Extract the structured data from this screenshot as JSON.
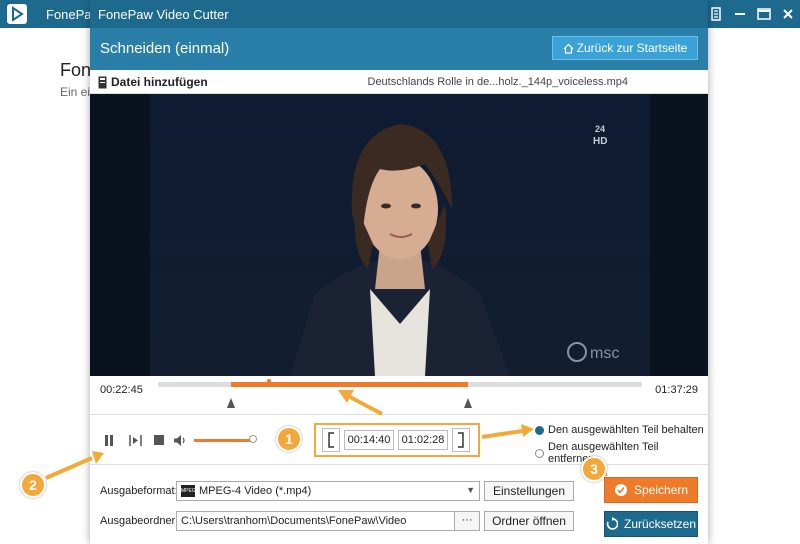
{
  "outer": {
    "title": "FonePaw",
    "heading": "Fone",
    "sub": "Ein ei"
  },
  "cutter": {
    "title": "FonePaw Video Cutter",
    "mode_title": "Schneiden (einmal)",
    "home_button": "Zurück zur Startseite"
  },
  "file": {
    "add_label": "Datei hinzufügen",
    "name": "Deutschlands Rolle in de...holz._144p_voiceless.mp4"
  },
  "video": {
    "channel_logo": "24 HD",
    "watermark": "msc"
  },
  "timeline": {
    "current_time": "00:22:45",
    "total_time": "01:37:29",
    "selection_start_fraction": 0.15,
    "selection_end_fraction": 0.64,
    "playhead_fraction": 0.23
  },
  "controls": {
    "volume_fraction": 0.95,
    "start_time": "00:14:40",
    "end_time": "01:02:28",
    "options": [
      {
        "label": "Den ausgewählten Teil behalten",
        "selected": true
      },
      {
        "label": "Den ausgewählten Teil entfernen",
        "selected": false
      }
    ]
  },
  "output": {
    "format_label": "Ausgabeformat:",
    "format_value": "MPEG-4 Video (*.mp4)",
    "format_icon_text": "MPEG",
    "settings_button": "Einstellungen",
    "folder_label": "Ausgabeordner:",
    "folder_value": "C:\\Users\\tranhom\\Documents\\FonePaw\\Video",
    "browse_button": "···",
    "open_folder_button": "Ordner öffnen",
    "save_button": "Speichern",
    "reset_button": "Zurücksetzen"
  },
  "annotations": {
    "badges": [
      "1",
      "2",
      "3"
    ]
  },
  "colors": {
    "title_bar": "#1e6a8f",
    "accent": "#ee7b2a",
    "highlight": "#f3a93a"
  },
  "icons": [
    "app-logo-icon",
    "close-icon",
    "menu-icon",
    "minimize-icon",
    "maximize-icon",
    "home-icon",
    "file-icon",
    "pause-icon",
    "next-frame-icon",
    "stop-icon",
    "volume-icon",
    "check-icon",
    "reset-icon"
  ]
}
